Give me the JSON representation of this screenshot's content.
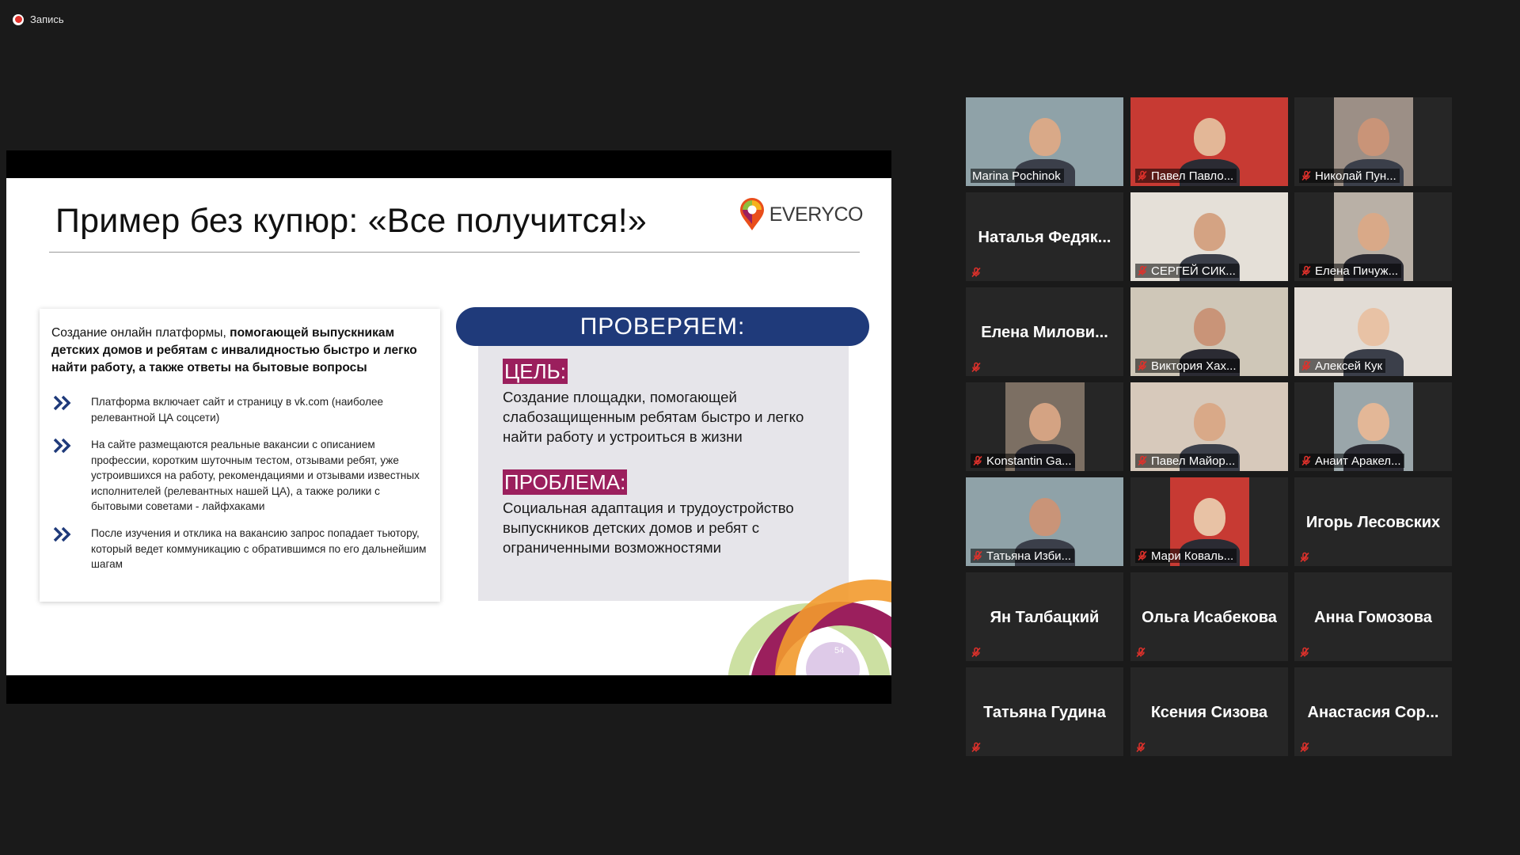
{
  "recording": {
    "label": "Запись"
  },
  "slide": {
    "title": "Пример без купюр: «Все получится!»",
    "logo_text": "EVERYCO",
    "lead_normal": "Создание онлайн платформы, ",
    "lead_bold": "помогающей выпускникам детских домов и ребятам с инвалидностью быстро и легко найти работу, а также ответы на бытовые вопросы",
    "bullets": [
      "Платформа включает сайт и страницу в vk.com (наиболее релевантной ЦА соцсети)",
      "На сайте размещаются реальные вакансии с описанием профессии, коротким шуточным тестом, отзывами ребят, уже устроившихся на работу, рекомендациями и отзывами известных исполнителей (релевантных нашей ЦА), а также ролики с бытовыми советами - лайфхаками",
      "После изучения и отклика на вакансию запрос попадает тьютору, который ведет коммуникацию с обратившимся по его дальнейшим шагам"
    ],
    "check_header": "ПРОВЕРЯЕМ:",
    "goal_tag": "ЦЕЛЬ:",
    "goal_text": "Создание площадки, помогающей слабозащищенным ребятам быстро и легко найти работу и устроиться в жизни",
    "problem_tag": "ПРОБЛЕМА:",
    "problem_text": "Социальная адаптация и трудоустройство выпускников детских домов и ребят с ограниченными возможностями",
    "page_number": "54"
  },
  "participants": [
    {
      "name": "Marina Pochinok",
      "video": true,
      "active": true
    },
    {
      "name": "Павел Павло...",
      "video": true
    },
    {
      "name": "Николай Пун...",
      "video": true
    },
    {
      "name": "Наталья Федяк...",
      "video": false
    },
    {
      "name": "СЕРГЕЙ СИК...",
      "video": true
    },
    {
      "name": "Елена Пичуж...",
      "video": true
    },
    {
      "name": "Елена Милови...",
      "video": false
    },
    {
      "name": "Виктория Хах...",
      "video": true
    },
    {
      "name": "Алексей Кук",
      "video": true
    },
    {
      "name": "Konstantin Ga...",
      "video": true
    },
    {
      "name": "Павел Майор...",
      "video": true
    },
    {
      "name": "Анаит Аракел...",
      "video": true
    },
    {
      "name": "Татьяна Изби...",
      "video": true
    },
    {
      "name": "Мари Коваль...",
      "video": true
    },
    {
      "name": "Игорь Лесовских",
      "video": false
    },
    {
      "name": "Ян Талбацкий",
      "video": false
    },
    {
      "name": "Ольга Исабекова",
      "video": false
    },
    {
      "name": "Анна Гомозова",
      "video": false
    },
    {
      "name": "Татьяна Гудина",
      "video": false
    },
    {
      "name": "Ксения Сизова",
      "video": false
    },
    {
      "name": "Анастасия Сор...",
      "video": false
    }
  ]
}
